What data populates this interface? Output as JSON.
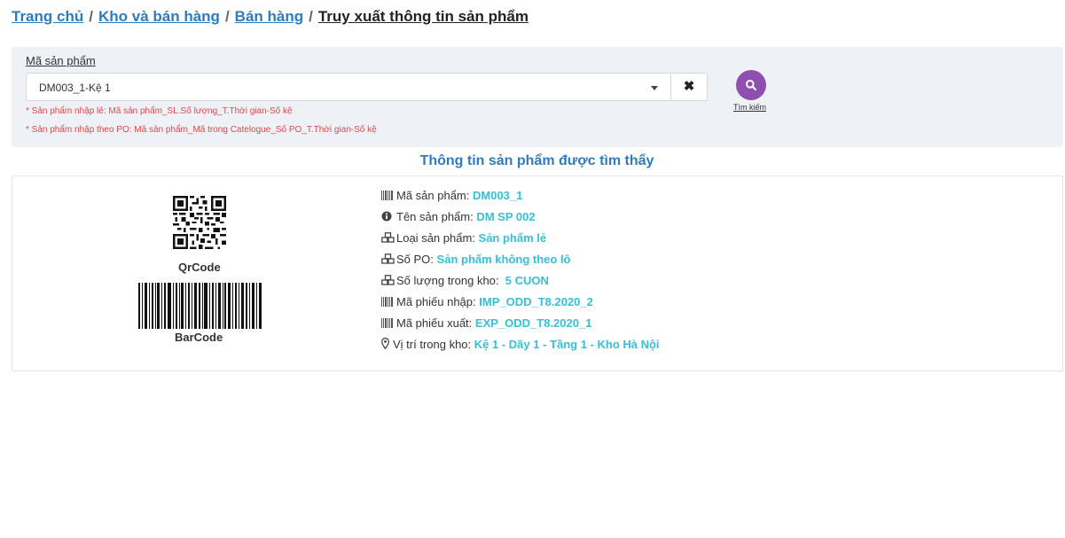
{
  "breadcrumb": {
    "home": "Trang chủ",
    "section": "Kho và bán hàng",
    "subsection": "Bán hàng",
    "current": "Truy xuất thông tin sản phẩm",
    "separator": "/"
  },
  "search": {
    "label": "Mã sản phẩm",
    "value": "DM003_1-Kệ 1",
    "clear_icon": "close-icon",
    "hint_single": "* Sản phẩm nhập lẻ: Mã sản phẩm_SL.Số lượng_T.Thời gian-Số kệ",
    "hint_po": "* Sản phẩm nhập theo PO: Mã sản phẩm_Mã trong Catelogue_Số PO_T.Thời gian-Số kệ",
    "button_label": "Tìm kiếm",
    "button_icon": "search-icon",
    "button_color": "#8e4fb1"
  },
  "result": {
    "title": "Thông tin sản phẩm được tìm thấy",
    "qr_label": "QrCode",
    "barcode_label": "BarCode",
    "fields": [
      {
        "icon": "barcode-icon",
        "label": "Mã sản phẩm:",
        "value": "DM003_1"
      },
      {
        "icon": "info-circle-icon",
        "label": "Tên sản phẩm:",
        "value": "DM SP 002"
      },
      {
        "icon": "cubes-icon",
        "label": "Loại sản phẩm:",
        "value": "Sản phẩm lẻ"
      },
      {
        "icon": "cubes-icon",
        "label": "Số PO:",
        "value": "Sản phẩm không theo lô"
      },
      {
        "icon": "cubes-icon",
        "label": "Số lượng trong kho:",
        "value": "5 CUON"
      },
      {
        "icon": "barcode-icon",
        "label": "Mã phiếu nhập:",
        "value": "IMP_ODD_T8.2020_2"
      },
      {
        "icon": "barcode-icon",
        "label": "Mã phiếu xuất:",
        "value": "EXP_ODD_T8.2020_1"
      },
      {
        "icon": "map-marker-icon",
        "label": "Vị trí trong kho:",
        "value": "Kệ 1 - Dãy 1 - Tầng 1 - Kho Hà Nội"
      }
    ]
  },
  "colors": {
    "link": "#2f7bbf",
    "value": "#35c0d6",
    "hint": "#e0474c",
    "panel": "#eef1f5"
  }
}
